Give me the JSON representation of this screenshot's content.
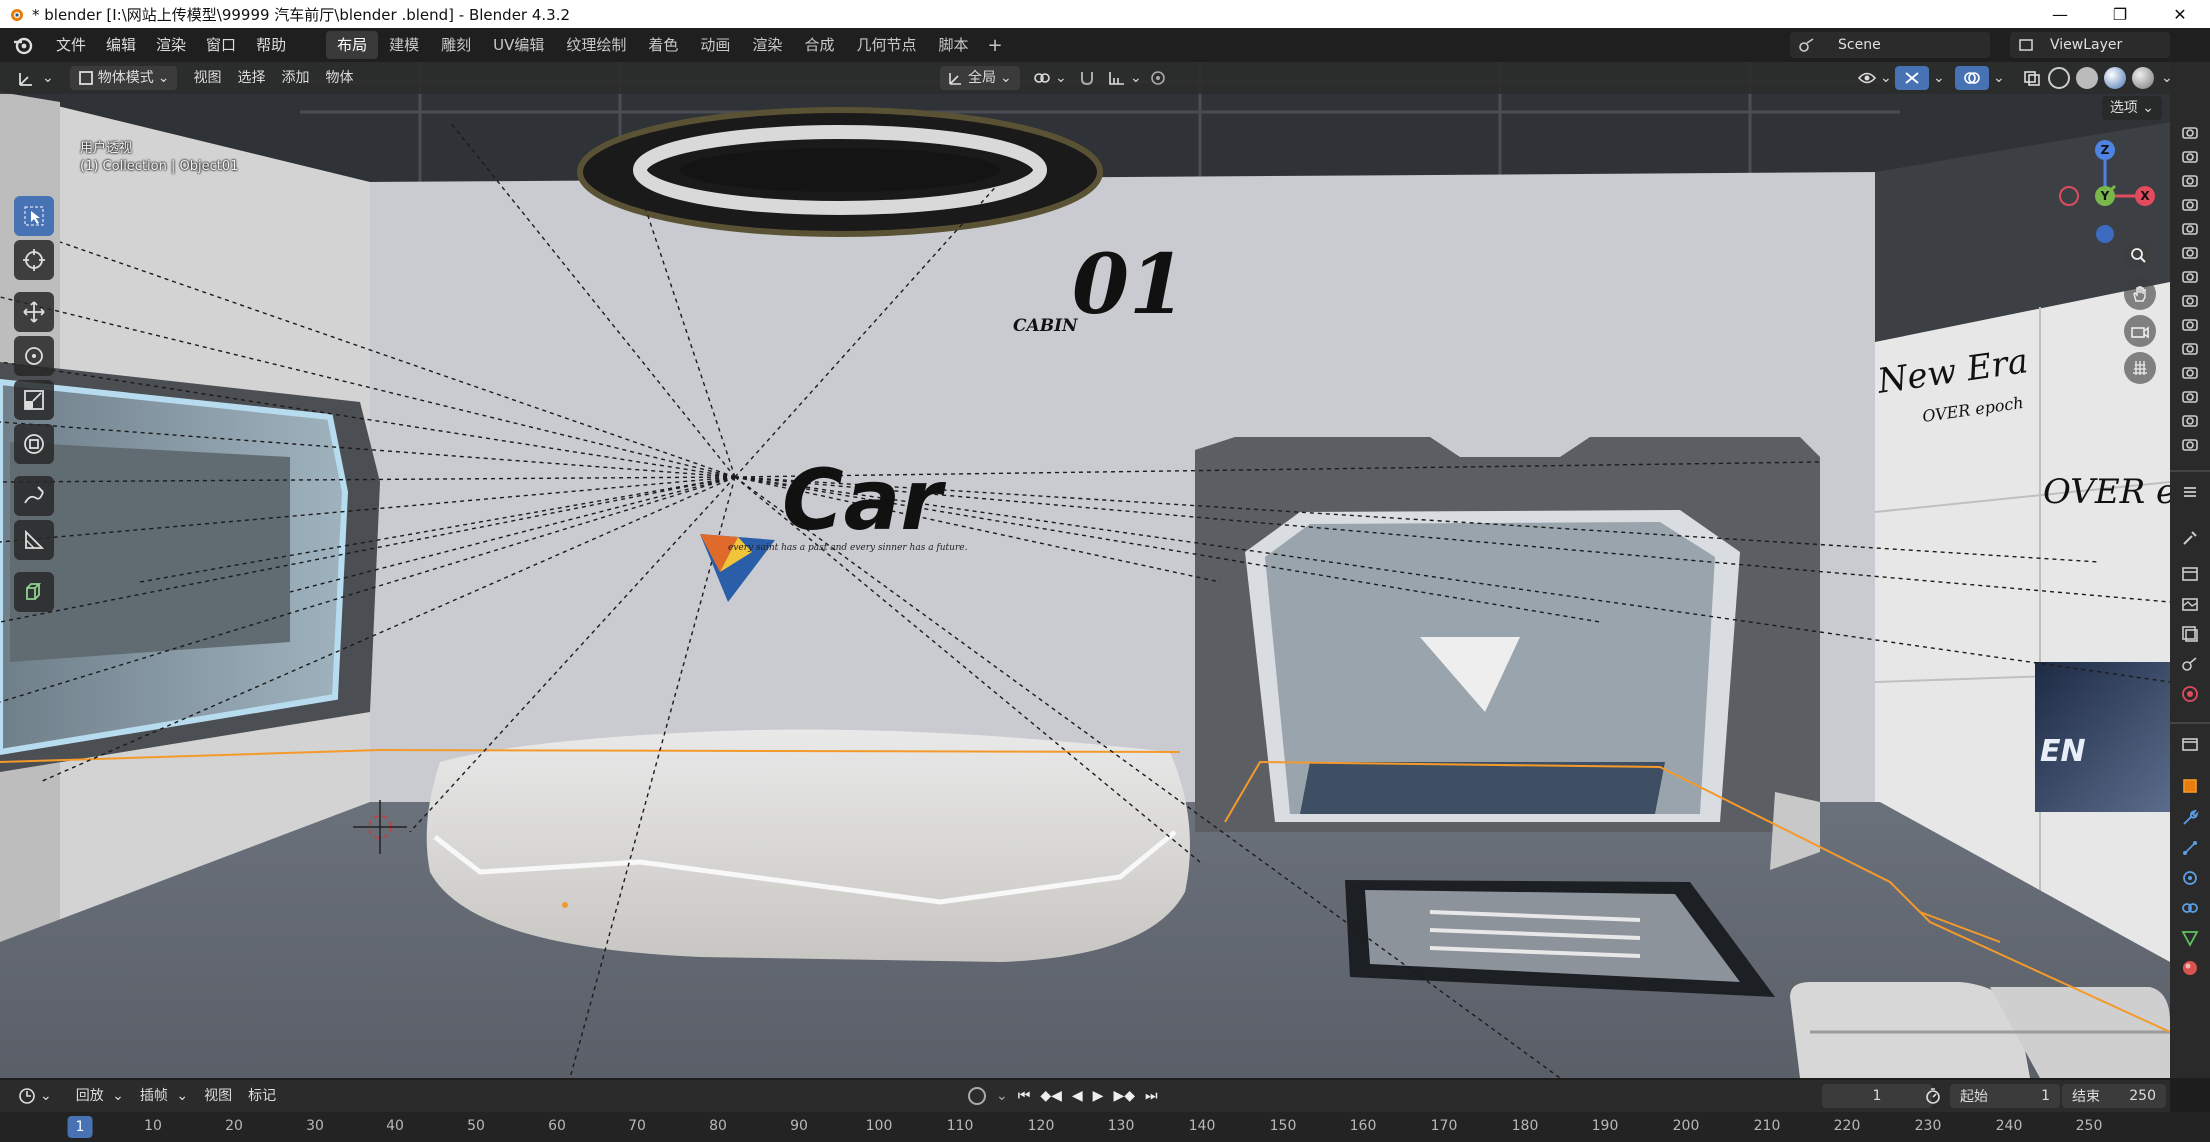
{
  "window": {
    "title": "* blender  [I:\\网站上传模型\\99999 汽车前厅\\blender .blend] - Blender 4.3.2",
    "controls": [
      "—",
      "❐",
      "✕"
    ]
  },
  "topbar": {
    "menus": [
      "文件",
      "编辑",
      "渲染",
      "窗口",
      "帮助"
    ],
    "workspaces": [
      "布局",
      "建模",
      "雕刻",
      "UV编辑",
      "纹理绘制",
      "着色",
      "动画",
      "渲染",
      "合成",
      "几何节点",
      "脚本"
    ],
    "active_workspace": "布局",
    "add_tab": "+",
    "scene_name": "Scene",
    "view_layer": "ViewLayer"
  },
  "viewport_header": {
    "mode": "物体模式",
    "menus": [
      "视图",
      "选择",
      "添加",
      "物体"
    ],
    "transform_orientation": "全局",
    "options_label": "选项"
  },
  "viewport": {
    "view_name": "用户透视",
    "collection_info": "(1) Collection | Object01",
    "scene_text": {
      "cabin_small": "CABIN",
      "cabin_number": "01",
      "car_logo": "Car",
      "car_tagline": "every saint has a past and every sinner has a future.",
      "wall_new_era": "New Era",
      "wall_over_epoch_small": "OVER epoch",
      "wall_over_epoch": "OVER epoch",
      "screen_text": "EN"
    },
    "gizmo": {
      "z": "Z",
      "y": "Y",
      "x": "X"
    }
  },
  "toolbar": {
    "tools": [
      "select-box",
      "cursor",
      "move",
      "rotate",
      "scale",
      "transform",
      "annotate",
      "measure",
      "add-cube"
    ]
  },
  "timeline": {
    "menus": [
      "回放",
      "插帧",
      "视图",
      "标记"
    ],
    "current_frame": "1",
    "start_label": "起始",
    "start_value": "1",
    "end_label": "结束",
    "end_value": "250",
    "ruler": [
      "1",
      "10",
      "20",
      "30",
      "40",
      "50",
      "60",
      "70",
      "80",
      "90",
      "100",
      "110",
      "120",
      "130",
      "140",
      "150",
      "160",
      "170",
      "180",
      "190",
      "200",
      "210",
      "220",
      "230",
      "240",
      "250"
    ]
  }
}
